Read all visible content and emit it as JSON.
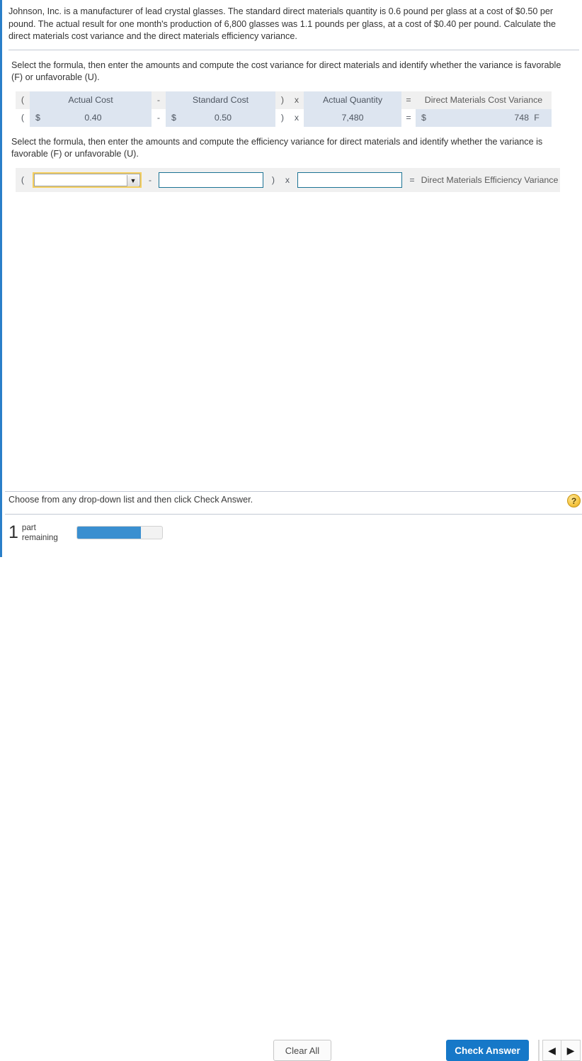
{
  "problem": {
    "text": "Johnson, Inc. is a manufacturer of lead crystal glasses. The standard direct materials quantity is 0.6 pound per glass at a cost of $0.50 per pound. The actual result for one month's production of 6,800 glasses was 1.1 pounds per glass, at a cost of $0.40 per pound. Calculate the direct materials cost variance and the direct materials efficiency variance."
  },
  "section1": {
    "instruction": "Select the formula, then enter the amounts and compute the cost variance for direct materials and identify whether the variance is favorable (F) or unfavorable (U).",
    "header": {
      "open_paren": "(",
      "col1": "Actual Cost",
      "minus": "-",
      "col2": "Standard Cost",
      "close_paren": ")",
      "times": "x",
      "col3": "Actual Quantity",
      "equals": "=",
      "result": "Direct Materials Cost Variance"
    },
    "values": {
      "open_paren": "(",
      "actual_cost_currency": "$",
      "actual_cost": "0.40",
      "minus": "-",
      "standard_cost_currency": "$",
      "standard_cost": "0.50",
      "close_paren": ")",
      "times": "x",
      "actual_quantity": "7,480",
      "equals": "=",
      "variance_currency": "$",
      "variance": "748",
      "variance_flag": "F"
    }
  },
  "section2": {
    "instruction": "Select the formula, then enter the amounts and compute the efficiency variance for direct materials and identify whether the variance is favorable (F) or unfavorable (U).",
    "open_paren": "(",
    "formula_select_value": "",
    "formula_select_placeholder": "",
    "dropdown_arrow": "▼",
    "minus": "-",
    "input2_value": "",
    "close_paren": ")",
    "times": "x",
    "input3_value": "",
    "equals": "=",
    "result_label": "Direct Materials Efficiency Variance"
  },
  "footer": {
    "hint": "Choose from any drop-down list and then click Check Answer.",
    "help_icon_label": "?",
    "parts_count": "1",
    "parts_line1": "part",
    "parts_line2": "remaining",
    "progress_percent": 75,
    "clear_all_label": "Clear All",
    "check_answer_label": "Check Answer",
    "prev_arrow": "◀",
    "next_arrow": "▶"
  },
  "colors": {
    "accent_blue": "#2a7fc9",
    "button_blue": "#1678c8",
    "cell_blue": "#dde5f0",
    "cell_gray": "#f0f0f0",
    "highlight_yellow": "#f5cf5e",
    "input_border_teal": "#1b7394",
    "progress_blue": "#3a8fd0"
  }
}
